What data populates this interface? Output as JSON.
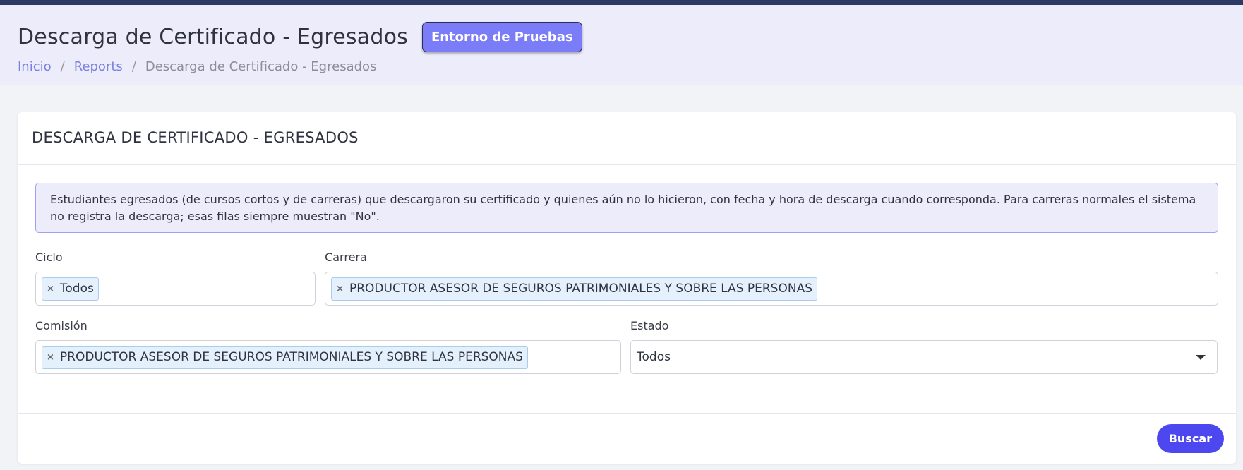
{
  "header": {
    "title": "Descarga de Certificado - Egresados",
    "env_badge": "Entorno de Pruebas",
    "breadcrumb": {
      "home": "Inicio",
      "sep1": "/",
      "reports": "Reports",
      "sep2": "/",
      "current": "Descarga de Certificado - Egresados"
    }
  },
  "card": {
    "title": "DESCARGA DE CERTIFICADO - EGRESADOS",
    "info": "Estudiantes egresados (de cursos cortos y de carreras) que descargaron su certificado y quienes aún no lo hicieron, con fecha y hora de descarga cuando corresponda. Para carreras normales el sistema no registra la descarga; esas filas siempre muestran \"No\"."
  },
  "filters": {
    "ciclo": {
      "label": "Ciclo",
      "selected": "Todos",
      "remove": "×"
    },
    "carrera": {
      "label": "Carrera",
      "selected": "PRODUCTOR ASESOR DE SEGUROS PATRIMONIALES Y SOBRE LAS PERSONAS",
      "remove": "×"
    },
    "comision": {
      "label": "Comisión",
      "selected": "PRODUCTOR ASESOR DE SEGUROS PATRIMONIALES Y SOBRE LAS PERSONAS",
      "remove": "×"
    },
    "estado": {
      "label": "Estado",
      "selected": "Todos"
    }
  },
  "footer": {
    "search_button": "Buscar"
  },
  "colors": {
    "topbar": "#2d3a66",
    "header_bg": "#ececfb",
    "accent": "#4d47f0",
    "badge": "#7b7cf7"
  }
}
